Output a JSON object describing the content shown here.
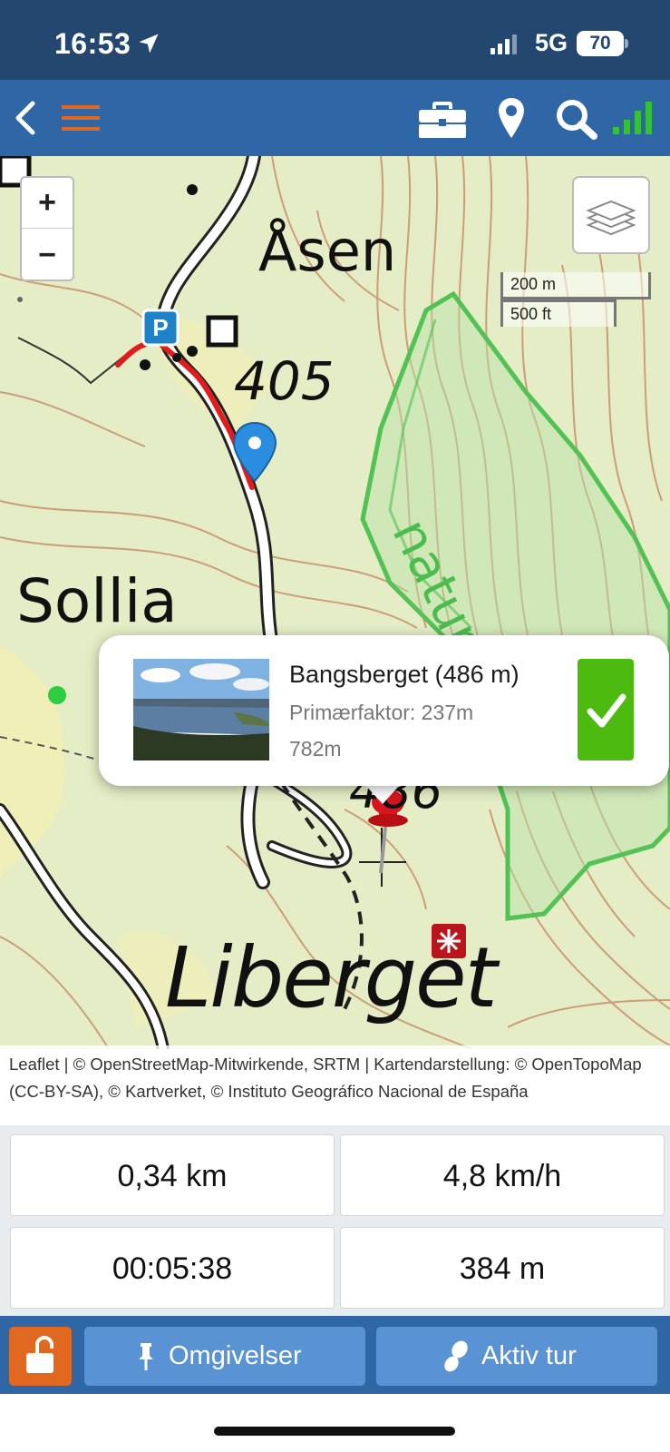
{
  "status_bar": {
    "time": "16:53",
    "network": "5G",
    "battery": "70",
    "icons": [
      "location-arrow-icon",
      "cellular-signal-icon",
      "battery-icon"
    ]
  },
  "toolbar": {
    "icons": [
      "back-chevron-icon",
      "hamburger-menu-icon",
      "briefcase-icon",
      "map-pin-icon",
      "search-icon",
      "gps-signal-icon"
    ],
    "menu_color": "#e06820",
    "signal_color": "#35c13a"
  },
  "map": {
    "labels": {
      "asen": "Åsen",
      "elev_405": "405",
      "sollia": "Sollia",
      "elev_486": "486",
      "liberget": "Liberget",
      "nature": "nature"
    },
    "zoom_in": "+",
    "zoom_out": "−",
    "scale": {
      "metric": "200 m",
      "imperial": "500 ft"
    },
    "attribution": "Leaflet | © OpenStreetMap-Mitwirkende, SRTM | Kartendarstellung: © OpenTopoMap (CC-BY-SA), © Kartverket, © Instituto Geográfico Nacional de España",
    "parking_label": "P"
  },
  "popup": {
    "title": "Bangsberget (486 m)",
    "prominence": "Primærfaktor: 237m",
    "distance": "782m",
    "checked": true
  },
  "stats": {
    "distance": "0,34 km",
    "speed": "4,8 km/h",
    "duration": "00:05:38",
    "elevation": "384 m"
  },
  "bottom_nav": {
    "surroundings_label": "Omgivelser",
    "active_trip_label": "Aktiv tur",
    "lock_color": "#e06820"
  },
  "colors": {
    "status_bar": "#23476e",
    "toolbar": "#2e66a6",
    "accent_green": "#4cba0e",
    "button_blue": "#5a93d3"
  }
}
